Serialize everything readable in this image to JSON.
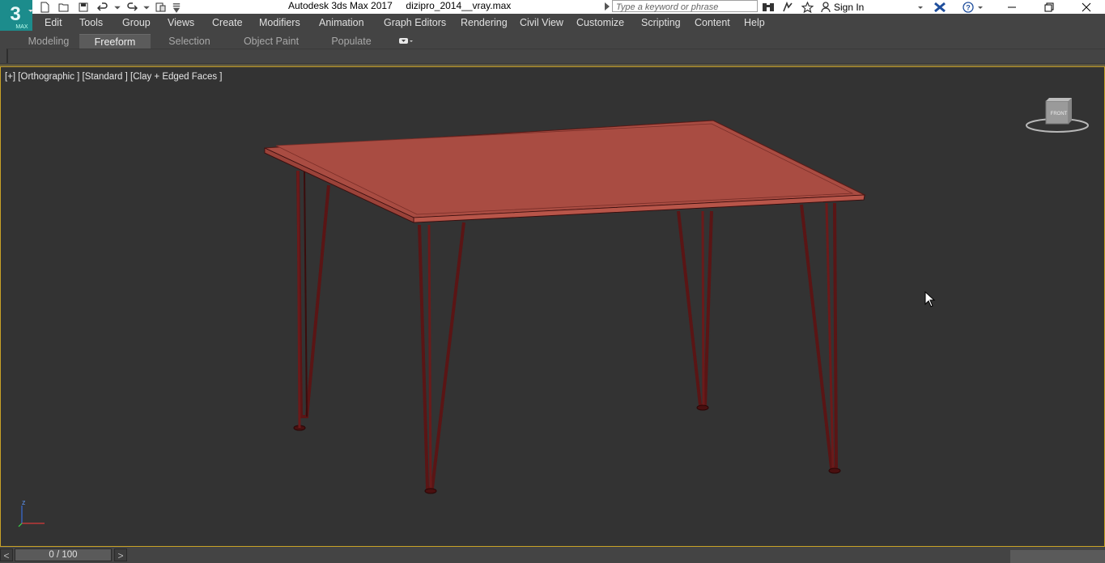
{
  "title_bar": {
    "app_name": "Autodesk 3ds Max 2017",
    "file_name": "dizipro_2014__vray.max",
    "search_placeholder": "Type a keyword or phrase",
    "sign_in_label": "Sign In",
    "logo_text": "3",
    "logo_sub": "MAX"
  },
  "menu": {
    "items": [
      "Edit",
      "Tools",
      "Group",
      "Views",
      "Create",
      "Modifiers",
      "Animation",
      "Graph Editors",
      "Rendering",
      "Civil View",
      "Customize",
      "Scripting",
      "Content",
      "Help"
    ]
  },
  "ribbon": {
    "tabs": [
      "Modeling",
      "Freeform",
      "Selection",
      "Object Paint",
      "Populate"
    ],
    "active_tab": "Freeform"
  },
  "viewport": {
    "label": "[+] [Orthographic ] [Standard ] [Clay + Edged Faces ]",
    "viewcube_face": "FRONT",
    "axis_label": "z",
    "table_top_color": "#a94c42",
    "table_edge_color": "#c45b4f",
    "leg_color": "#5a1515",
    "border_color": "#c9a227"
  },
  "timeline": {
    "frame_display": "0 / 100",
    "prev_label": "<",
    "next_label": ">"
  },
  "icons": {
    "quick_access": [
      "new-file-icon",
      "open-file-icon",
      "save-icon",
      "undo-icon",
      "redo-icon",
      "project-icon"
    ],
    "info_center": [
      "binoculars-icon",
      "communication-icon",
      "favorites-star-icon"
    ],
    "window": [
      "minimize-icon",
      "restore-icon",
      "close-icon"
    ]
  }
}
